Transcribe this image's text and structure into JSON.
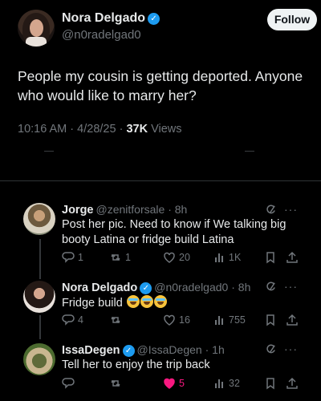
{
  "post": {
    "author_name": "Nora Delgado",
    "author_handle": "@n0radelgad0",
    "follow_label": "Follow",
    "text": "People my cousin is getting deported. Anyone who would like to marry her?",
    "time": "10:16 AM",
    "date": "4/28/25",
    "views_count": "37K",
    "views_label": "Views"
  },
  "replies": [
    {
      "name": "Jorge",
      "handle": "@zenitforsale",
      "time": "8h",
      "text": "Post her pic. Need to know if We talking big booty Latina or fridge build Latina",
      "verified": false,
      "replies": "1",
      "reposts": "1",
      "likes": "20",
      "views": "1K"
    },
    {
      "name": "Nora Delgado",
      "handle": "@n0radelgad0",
      "time": "8h",
      "text": "Fridge build",
      "verified": true,
      "replies": "4",
      "reposts": "",
      "likes": "16",
      "views": "755"
    },
    {
      "name": "IssaDegen",
      "handle": "@IssaDegen",
      "time": "1h",
      "text": "Tell her to enjoy the trip back",
      "verified": true,
      "replies": "",
      "reposts": "",
      "likes": "5",
      "views": "32"
    }
  ],
  "colors": {
    "accent": "#1d9bf0",
    "like": "#f91880",
    "muted": "#71767b"
  },
  "icons": {
    "verified": "verified-badge-icon",
    "reply": "reply-icon",
    "repost": "repost-icon",
    "like": "heart-icon",
    "views": "views-icon",
    "bookmark": "bookmark-icon",
    "share": "share-icon",
    "grok": "grok-icon",
    "more": "more-icon"
  }
}
